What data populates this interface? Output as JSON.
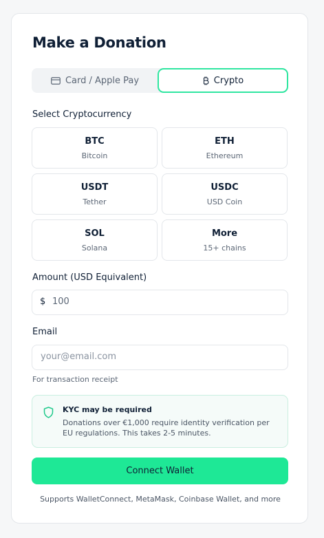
{
  "title": "Make a Donation",
  "tabs": {
    "card_label": "Card / Apple Pay",
    "crypto_label": "Crypto",
    "active": "crypto"
  },
  "select_label": "Select Cryptocurrency",
  "coins": [
    {
      "symbol": "BTC",
      "name": "Bitcoin"
    },
    {
      "symbol": "ETH",
      "name": "Ethereum"
    },
    {
      "symbol": "USDT",
      "name": "Tether"
    },
    {
      "symbol": "USDC",
      "name": "USD Coin"
    },
    {
      "symbol": "SOL",
      "name": "Solana"
    },
    {
      "symbol": "More",
      "name": "15+ chains"
    }
  ],
  "amount": {
    "label": "Amount (USD Equivalent)",
    "currency_symbol": "$",
    "value": "100"
  },
  "email": {
    "label": "Email",
    "placeholder": "your@email.com",
    "hint": "For transaction receipt"
  },
  "kyc_notice": {
    "title": "KYC may be required",
    "text": "Donations over €1,000 require identity verification per EU regulations. This takes 2-5 minutes."
  },
  "connect_button": "Connect Wallet",
  "supports_text": "Supports WalletConnect, MetaMask, Coinbase Wallet, and more",
  "colors": {
    "accent": "#1ee896",
    "accent_border": "#2ee6a0",
    "text": "#0f1f35",
    "muted": "#5b6675",
    "notice_bg": "#f5fbf9"
  },
  "icons": {
    "card_tab": "credit-card-icon",
    "crypto_tab": "bitcoin-icon",
    "notice": "shield-icon"
  }
}
